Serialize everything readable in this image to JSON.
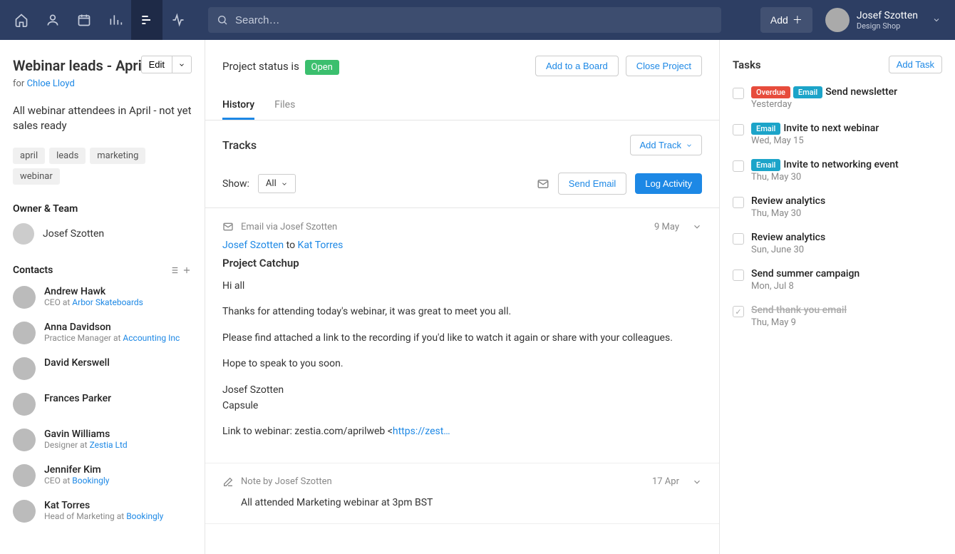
{
  "topnav": {
    "search_placeholder": "Search…",
    "add_label": "Add",
    "user_name": "Josef Szotten",
    "user_sub": "Design Shop"
  },
  "sidebar": {
    "title": "Webinar leads - April",
    "for_prefix": "for ",
    "for_link": "Chloe Lloyd",
    "edit_label": "Edit",
    "description": "All webinar attendees in April - not yet sales ready",
    "tags": [
      "april",
      "leads",
      "marketing",
      "webinar"
    ],
    "owner_team_label": "Owner & Team",
    "owner_name": "Josef Szotten",
    "contacts_label": "Contacts",
    "contacts": [
      {
        "name": "Andrew Hawk",
        "role_prefix": "CEO at ",
        "company": "Arbor Skateboards"
      },
      {
        "name": "Anna Davidson",
        "role_prefix": "Practice Manager at ",
        "company": "Accounting Inc"
      },
      {
        "name": "David Kerswell",
        "role_prefix": "",
        "company": ""
      },
      {
        "name": "Frances Parker",
        "role_prefix": "",
        "company": ""
      },
      {
        "name": "Gavin Williams",
        "role_prefix": "Designer at ",
        "company": "Zestia Ltd"
      },
      {
        "name": "Jennifer Kim",
        "role_prefix": "CEO at ",
        "company": "Bookingly"
      },
      {
        "name": "Kat Torres",
        "role_prefix": "Head of Marketing at ",
        "company": "Bookingly"
      }
    ]
  },
  "main": {
    "status_prefix": "Project status is ",
    "status_value": "Open",
    "add_to_board": "Add to a Board",
    "close_project": "Close Project",
    "tabs": {
      "history": "History",
      "files": "Files"
    },
    "tracks_label": "Tracks",
    "add_track": "Add Track",
    "show_label": "Show:",
    "show_value": "All",
    "send_email": "Send Email",
    "log_activity": "Log Activity",
    "activities": [
      {
        "type": "email",
        "meta": "Email via Josef Szotten",
        "date": "9 May",
        "from": "Josef Szotten",
        "to_word": " to ",
        "to": "Kat Torres",
        "subject": "Project Catchup",
        "body_lines": [
          "Hi all",
          "Thanks for attending today's webinar, it was great to meet you all.",
          "Please find attached a link to the recording if you'd like to watch it again or share with your colleagues.",
          "Hope to speak to you soon.",
          "Josef Szotten\nCapsule"
        ],
        "link_prefix": "Link to webinar: zestia.com/aprilweb <",
        "link_text": "https://zest…"
      },
      {
        "type": "note",
        "meta": "Note by Josef Szotten",
        "date": "17 Apr",
        "note_text": "All attended Marketing webinar at 3pm BST"
      }
    ]
  },
  "tasks": {
    "heading": "Tasks",
    "add_task": "Add Task",
    "items": [
      {
        "badges": [
          "Overdue",
          "Email"
        ],
        "title": "Send newsletter",
        "date": "Yesterday",
        "done": false
      },
      {
        "badges": [
          "Email"
        ],
        "title": "Invite to next webinar",
        "date": "Wed, May 15",
        "done": false
      },
      {
        "badges": [
          "Email"
        ],
        "title": "Invite to networking event",
        "date": "Thu, May 30",
        "done": false
      },
      {
        "badges": [],
        "title": "Review analytics",
        "date": "Thu, May 30",
        "done": false
      },
      {
        "badges": [],
        "title": "Review analytics",
        "date": "Sun, June 30",
        "done": false
      },
      {
        "badges": [],
        "title": "Send summer campaign",
        "date": "Mon, Jul 8",
        "done": false
      },
      {
        "badges": [],
        "title": "Send thank you email",
        "date": "Thu, May 9",
        "done": true
      }
    ]
  }
}
